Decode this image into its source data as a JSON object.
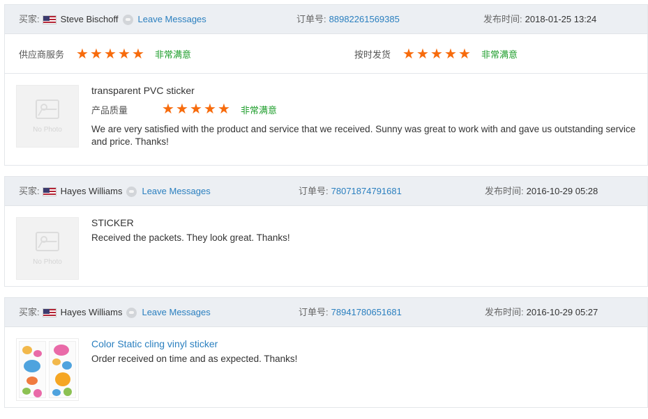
{
  "labels": {
    "buyer": "买家:",
    "order_no": "订单号:",
    "post_time": "发布时间:",
    "leave_messages": "Leave Messages",
    "supplier_service": "供应商服务",
    "on_time_delivery": "按时发货",
    "product_quality": "产品质量",
    "no_photo": "No Photo"
  },
  "colors": {
    "header_bg": "#eceff3",
    "link": "#2a7fbf",
    "star": "#f76b0c",
    "satisfaction": "#1f9e2c"
  },
  "reviews": [
    {
      "buyer": "Steve Bischoff",
      "order_no": "88982261569385",
      "time": "2018-01-25 13:24",
      "supplier_service_stars": 5,
      "supplier_service_text": "非常满意",
      "on_time_delivery_stars": 5,
      "on_time_delivery_text": "非常满意",
      "product_title": "transparent PVC sticker",
      "product_quality_stars": 5,
      "product_quality_text": "非常满意",
      "comment": "We are very satisfied with the product and service that we received. Sunny was great to work with and gave us outstanding service and price. Thanks!"
    },
    {
      "buyer": "Hayes Williams",
      "order_no": "78071874791681",
      "time": "2016-10-29 05:28",
      "product_title": "STICKER",
      "comment": "Received the packets. They look great. Thanks!"
    },
    {
      "buyer": "Hayes Williams",
      "order_no": "78941780651681",
      "time": "2016-10-29 05:27",
      "product_title": "Color Static cling vinyl sticker",
      "comment": "Order received on time and as expected. Thanks!"
    }
  ]
}
